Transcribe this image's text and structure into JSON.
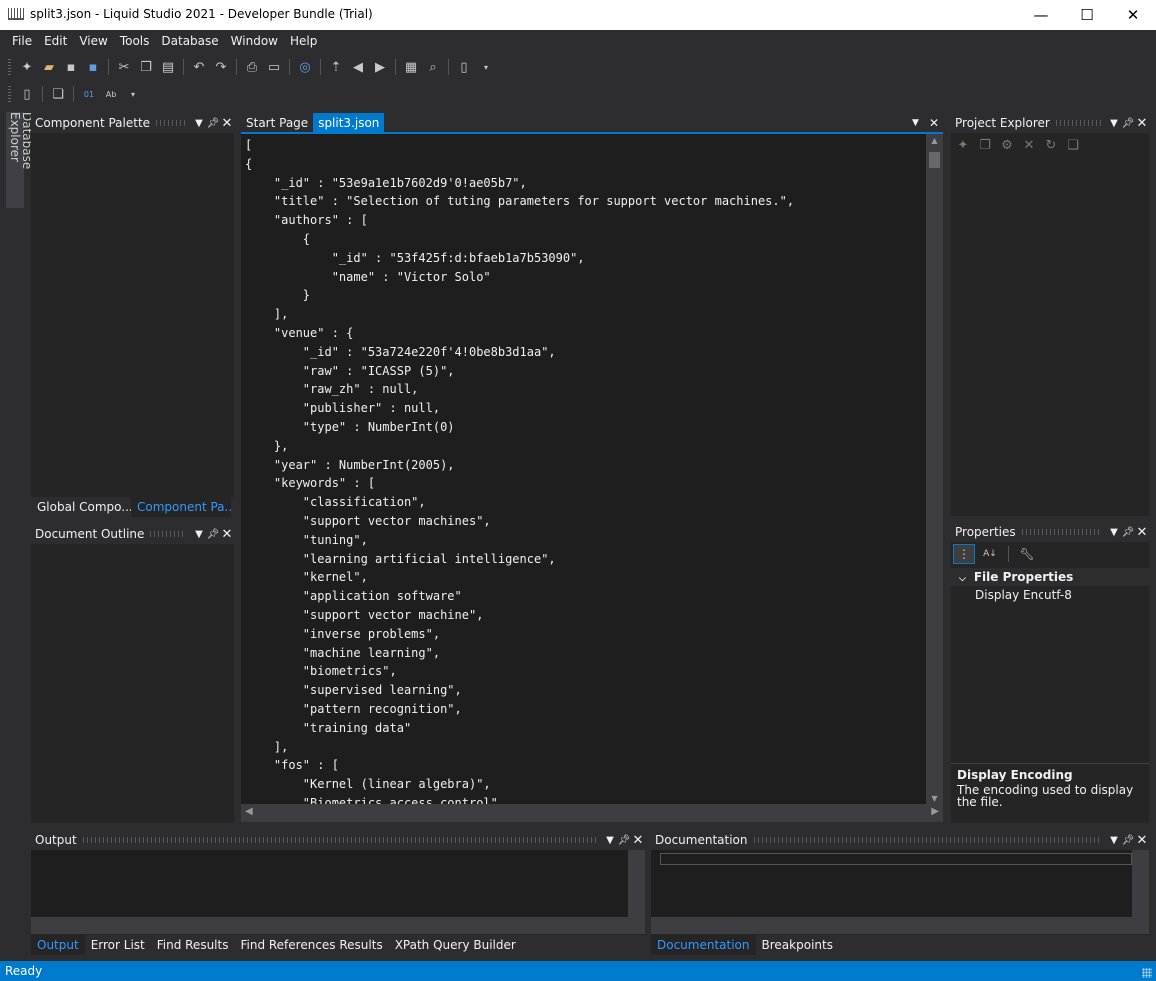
{
  "window": {
    "title": "split3.json - Liquid Studio 2021 - Developer Bundle (Trial)",
    "minimize": "—",
    "maximize": "☐",
    "close": "✕"
  },
  "menu": [
    "File",
    "Edit",
    "View",
    "Tools",
    "Database",
    "Window",
    "Help"
  ],
  "left_vertical_tab": "Database Explorer",
  "component_palette": {
    "title": "Component Palette",
    "tabs": [
      "Global Compo...",
      "Component Pa..."
    ]
  },
  "document_outline": {
    "title": "Document Outline"
  },
  "editor": {
    "tabs": [
      "Start Page",
      "split3.json"
    ],
    "lines": [
      "[",
      "{",
      "    \"_id\" : \"53e9a1e1b7602d9'0!ae05b7\",",
      "    \"title\" : \"Selection of tuting parameters for support vector machines.\",",
      "    \"authors\" : [",
      "        {",
      "            \"_id\" : \"53f425f:d:bfaeb1a7b53090\",",
      "            \"name\" : \"Victor Solo\"",
      "        }",
      "    ],",
      "    \"venue\" : {",
      "        \"_id\" : \"53a724e220f'4!0be8b3d1aa\",",
      "        \"raw\" : \"ICASSP (5)\",",
      "        \"raw_zh\" : null,",
      "        \"publisher\" : null,",
      "        \"type\" : NumberInt(0)",
      "    },",
      "    \"year\" : NumberInt(2005),",
      "    \"keywords\" : [",
      "        \"classification\",",
      "        \"support vector machines\",",
      "        \"tuning\",",
      "        \"learning artificial intelligence\",",
      "        \"kernel\",",
      "        \"application software\"",
      "        \"support vector machine\",",
      "        \"inverse problems\",",
      "        \"machine learning\",",
      "        \"biometrics\",",
      "        \"supervised learning\",",
      "        \"pattern recognition\",",
      "        \"training data\"",
      "    ],",
      "    \"fos\" : [",
      "        \"Kernel (linear algebra)\",",
      "        \"Biometrics access control\","
    ]
  },
  "project_explorer": {
    "title": "Project Explorer"
  },
  "properties": {
    "title": "Properties",
    "category": "File Properties",
    "row_name": "Display Encoding",
    "row_value": "utf-8",
    "desc_title": "Display Encoding",
    "desc_text": "The encoding used to display the file."
  },
  "output": {
    "title": "Output",
    "tabs": [
      "Output",
      "Error List",
      "Find Results",
      "Find References Results",
      "XPath Query Builder"
    ]
  },
  "documentation": {
    "title": "Documentation",
    "tabs": [
      "Documentation",
      "Breakpoints"
    ]
  },
  "status": {
    "text": "Ready"
  },
  "colors": {
    "accent": "#007acc",
    "background": "#2d2d30",
    "editor_bg": "#1e1e1e"
  }
}
